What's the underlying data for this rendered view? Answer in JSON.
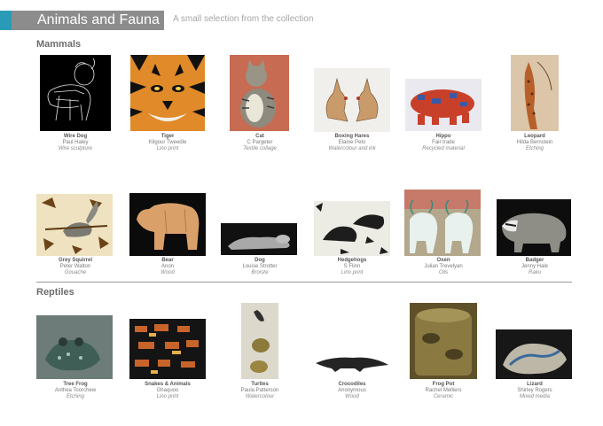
{
  "header": {
    "title": "Animals and Fauna",
    "subtitle": "A small selection from the collection"
  },
  "sections": {
    "mammals": "Mammals",
    "reptiles": "Reptiles"
  },
  "mammals_row1": [
    {
      "title": "Wire Dog",
      "artist": "Paul Haley",
      "medium": "Wire sculpture"
    },
    {
      "title": "Tiger",
      "artist": "Kilgour Tweedle",
      "medium": "Lino print"
    },
    {
      "title": "Cat",
      "artist": "C Pargeter",
      "medium": "Textile collage"
    },
    {
      "title": "Boxing Hares",
      "artist": "Elaine Peto",
      "medium": "Watercolour and ink"
    },
    {
      "title": "Hippo",
      "artist": "Fair trade",
      "medium": "Recycled material"
    },
    {
      "title": "Leopard",
      "artist": "Hilda Bernstein",
      "medium": "Etching"
    }
  ],
  "mammals_row2": [
    {
      "title": "Grey Squirrel",
      "artist": "Peter Walton",
      "medium": "Gouache"
    },
    {
      "title": "Bear",
      "artist": "Anon",
      "medium": "Wood"
    },
    {
      "title": "Dog",
      "artist": "Louise Strotter",
      "medium": "Bronze"
    },
    {
      "title": "Hedgehogs",
      "artist": "S Flinn",
      "medium": "Lino print"
    },
    {
      "title": "Oxen",
      "artist": "Julian Trevelyan",
      "medium": "Oils"
    },
    {
      "title": "Badger",
      "artist": "Jenny Hale",
      "medium": "Raku"
    }
  ],
  "reptiles_row": [
    {
      "title": "Tree Frog",
      "artist": "Anthea Toorchew",
      "medium": "Etching"
    },
    {
      "title": "Snakes & Animals",
      "artist": "Ghaquoo",
      "medium": "Lino print"
    },
    {
      "title": "Turtles",
      "artist": "Paula Patterson",
      "medium": "Watercolour"
    },
    {
      "title": "Crocodiles",
      "artist": "Anonymous",
      "medium": "Wood"
    },
    {
      "title": "Frog Pot",
      "artist": "Rachel Melliers",
      "medium": "Ceramic"
    },
    {
      "title": "Lizard",
      "artist": "Shirley Rogers",
      "medium": "Mixed media"
    }
  ],
  "colors": {
    "accent": "#2a9bb7",
    "title_bar": "#8c8c8c"
  }
}
